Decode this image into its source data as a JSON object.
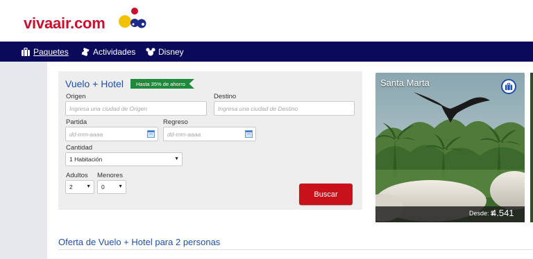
{
  "logo": {
    "text": "vivaair.com"
  },
  "nav": {
    "items": [
      {
        "label": "Paquetes",
        "icon": "suitcase-icon",
        "active": true
      },
      {
        "label": "Actividades",
        "icon": "ticket-icon",
        "active": false
      },
      {
        "label": "Disney",
        "icon": "mickey-icon",
        "active": false
      }
    ]
  },
  "search": {
    "title": "Vuelo + Hotel",
    "promo": "Hasta 35% de ahorro",
    "origin": {
      "label": "Origen",
      "placeholder": "Ingresa una ciudad de Origen",
      "value": ""
    },
    "destination": {
      "label": "Destino",
      "placeholder": "Ingresa una ciudad de Destino",
      "value": ""
    },
    "departure": {
      "label": "Partida",
      "placeholder": "dd-mm-aaaa",
      "value": ""
    },
    "return": {
      "label": "Regreso",
      "placeholder": "dd-mm-aaaa",
      "value": ""
    },
    "quantity": {
      "label": "Cantidad",
      "selected": "1 Habitación"
    },
    "adults": {
      "label": "Adultos",
      "selected": "2"
    },
    "minors": {
      "label": "Menores",
      "selected": "0"
    },
    "submit_label": "Buscar"
  },
  "destination_card": {
    "title": "Santa Marta",
    "price_prefix": "Desde:",
    "currency": "$",
    "price": "4.541",
    "badge_icon": "suitcase-icon"
  },
  "offers": {
    "heading": "Oferta de Vuelo + Hotel para 2 personas"
  },
  "colors": {
    "brand_red": "#c8102e",
    "nav_blue": "#0b0a5a",
    "link_blue": "#1f4fa8",
    "promo_green": "#1f8a3b",
    "button_red": "#c8111a"
  }
}
